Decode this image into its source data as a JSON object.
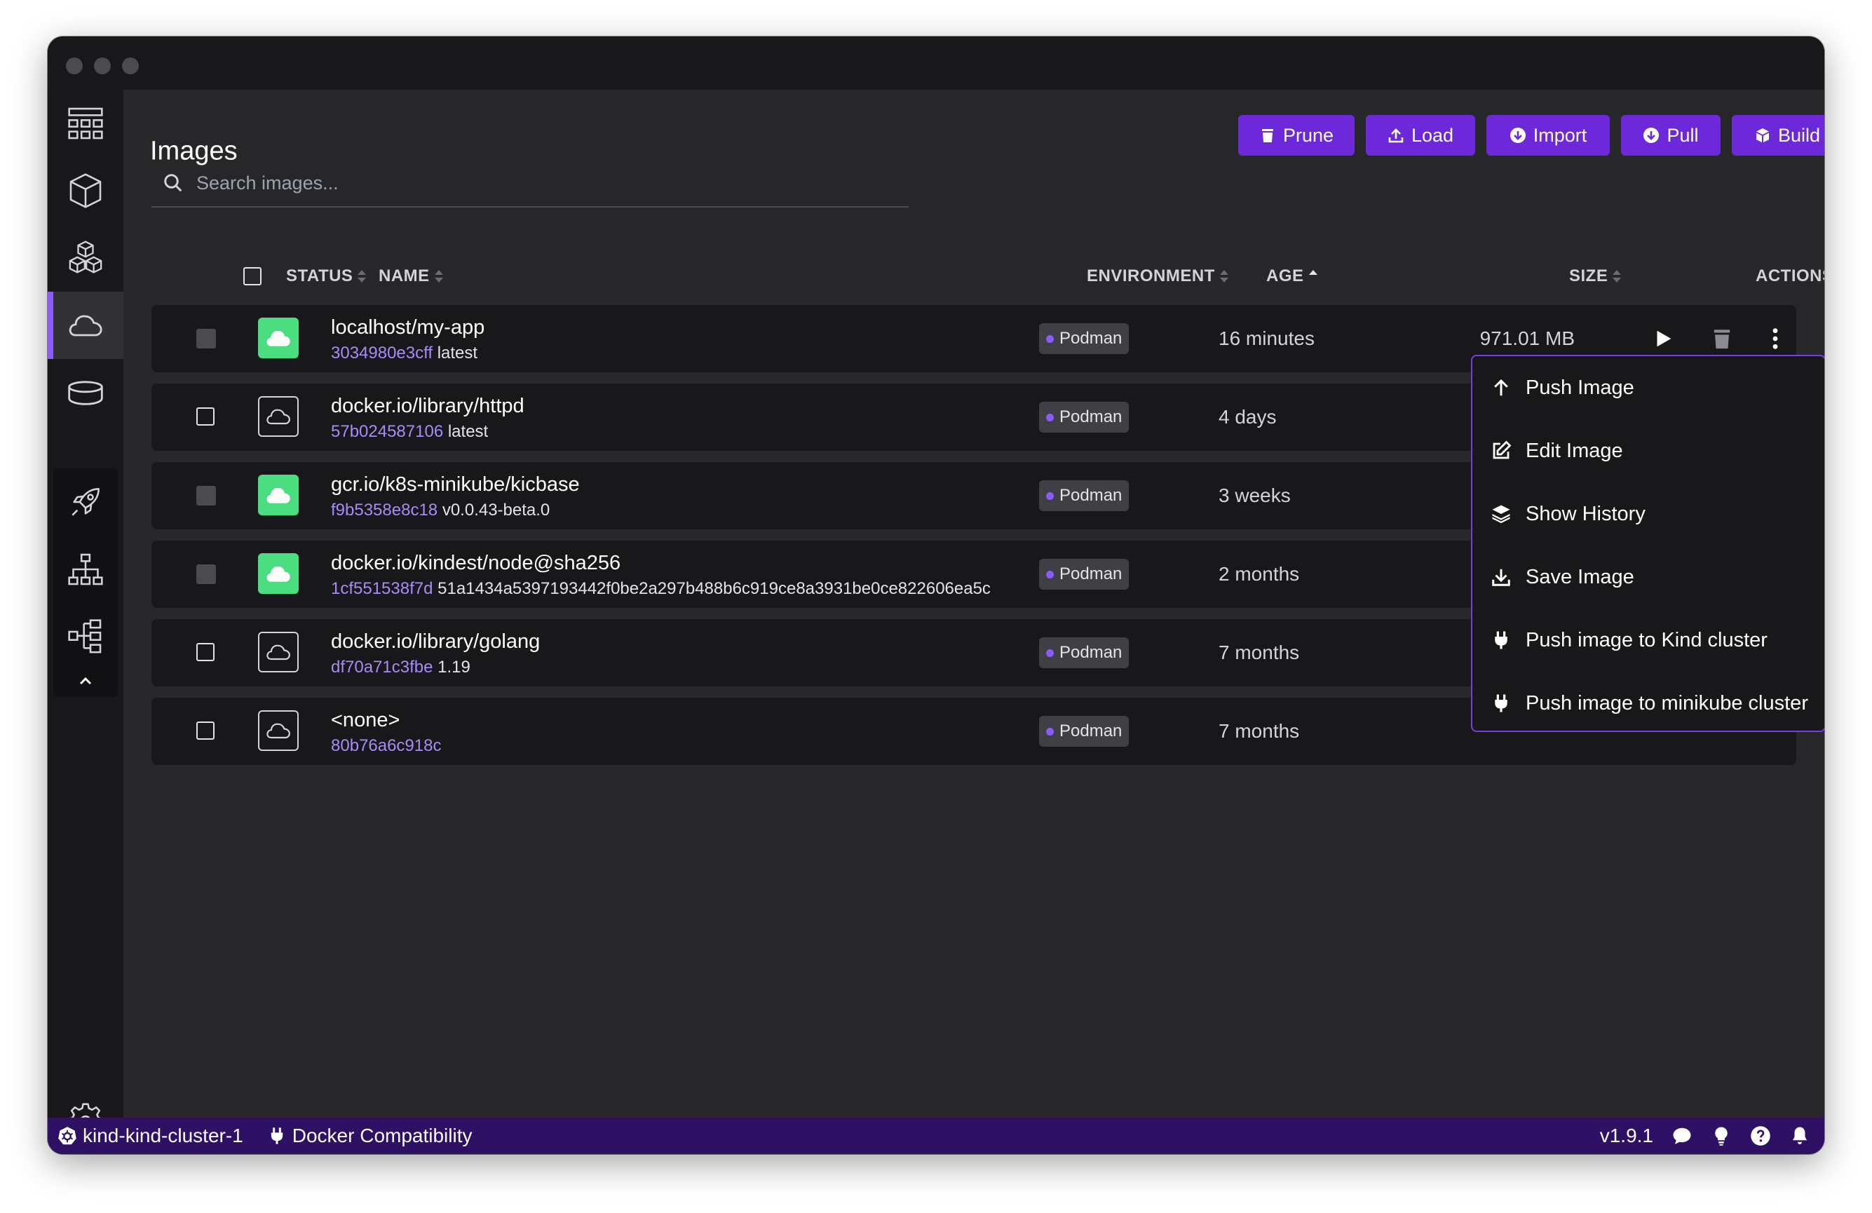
{
  "page": {
    "title": "Images",
    "search_placeholder": "Search images..."
  },
  "toolbar": {
    "prune": "Prune",
    "load": "Load",
    "import": "Import",
    "pull": "Pull",
    "build": "Build"
  },
  "table": {
    "headers": {
      "status": "STATUS",
      "name": "NAME",
      "environment": "ENVIRONMENT",
      "age": "AGE",
      "size": "SIZE",
      "actions": "ACTIONS"
    },
    "sort_column": "AGE",
    "rows": [
      {
        "name": "localhost/my-app",
        "id": "3034980e3cff",
        "tag": "latest",
        "environment": "Podman",
        "age": "16 minutes",
        "size": "971.01 MB",
        "in_use": true
      },
      {
        "name": "docker.io/library/httpd",
        "id": "57b024587106",
        "tag": "latest",
        "environment": "Podman",
        "age": "4 days",
        "size": "",
        "in_use": false
      },
      {
        "name": "gcr.io/k8s-minikube/kicbase",
        "id": "f9b5358e8c18",
        "tag": "v0.0.43-beta.0",
        "environment": "Podman",
        "age": "3 weeks",
        "size": "",
        "in_use": true
      },
      {
        "name": "docker.io/kindest/node@sha256",
        "id": "1cf551538f7d",
        "tag": "51a1434a5397193442f0be2a297b488b6c919ce8a3931be0ce822606ea5c",
        "environment": "Podman",
        "age": "2 months",
        "size": "",
        "in_use": true
      },
      {
        "name": "docker.io/library/golang",
        "id": "df70a71c3fbe",
        "tag": "1.19",
        "environment": "Podman",
        "age": "7 months",
        "size": "",
        "in_use": false
      },
      {
        "name": "<none>",
        "id": "80b76a6c918c",
        "tag": "",
        "environment": "Podman",
        "age": "7 months",
        "size": "",
        "in_use": false
      }
    ]
  },
  "context_menu": {
    "items": [
      {
        "label": "Push Image",
        "icon": "arrow-up-icon"
      },
      {
        "label": "Edit Image",
        "icon": "edit-icon"
      },
      {
        "label": "Show History",
        "icon": "layers-icon"
      },
      {
        "label": "Save Image",
        "icon": "download-icon"
      },
      {
        "label": "Push image to Kind cluster",
        "icon": "plug-icon"
      },
      {
        "label": "Push image to minikube cluster",
        "icon": "plug-icon"
      }
    ]
  },
  "statusbar": {
    "context": "kind-kind-cluster-1",
    "compat": "Docker Compatibility",
    "version": "v1.9.1"
  },
  "colors": {
    "accent": "#6d28d9",
    "in_use_green": "#4ade80",
    "statusbar_bg": "#2e1065",
    "image_id": "#a78bfa"
  }
}
